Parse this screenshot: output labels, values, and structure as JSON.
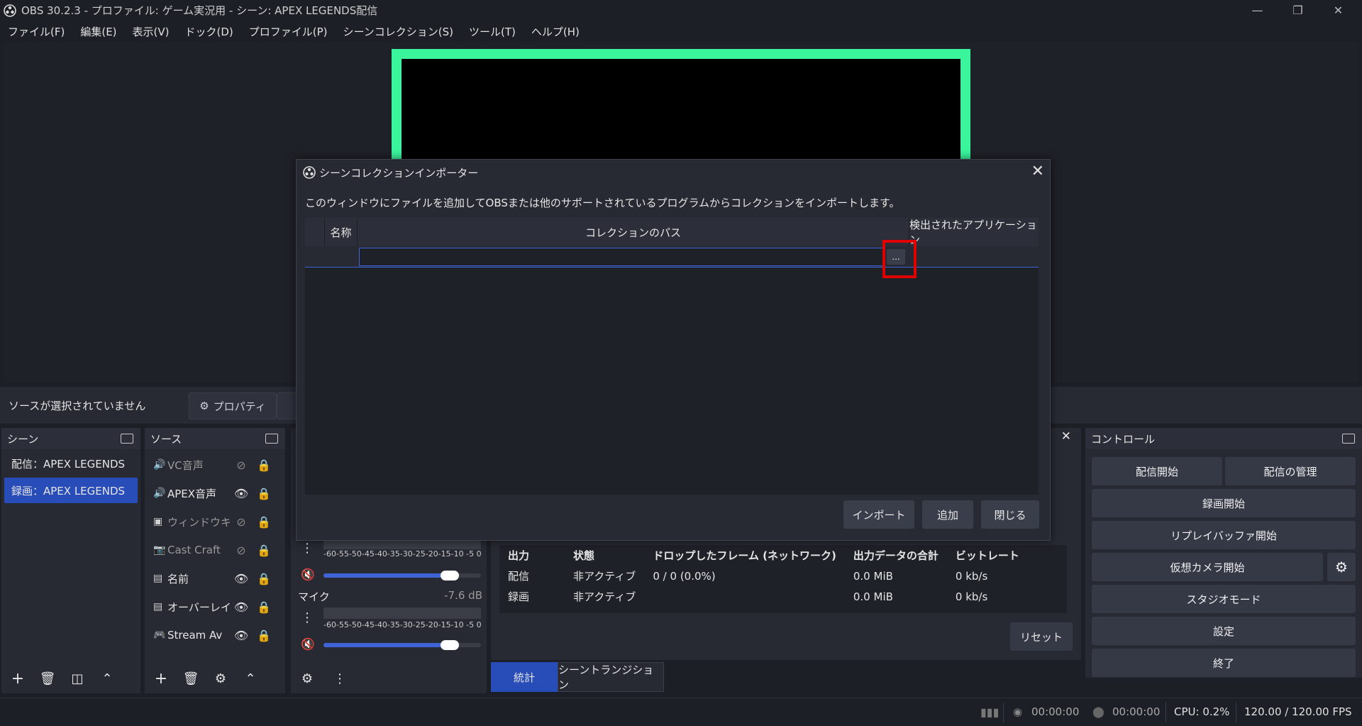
{
  "window": {
    "title": "OBS 30.2.3 - プロファイル: ゲーム実況用 - シーン: APEX LEGENDS配信"
  },
  "menu": [
    "ファイル(F)",
    "編集(E)",
    "表示(V)",
    "ドック(D)",
    "プロファイル(P)",
    "シーンコレクション(S)",
    "ツール(T)",
    "ヘルプ(H)"
  ],
  "source_bar": {
    "no_selection": "ソースが選択されていません",
    "properties": "プロパティ"
  },
  "scenes": {
    "title": "シーン",
    "items": [
      "配信：APEX LEGENDS",
      "録画：APEX LEGENDS"
    ],
    "selected_index": 1
  },
  "sources": {
    "title": "ソース",
    "items": [
      {
        "name": "VC音声",
        "icon": "speaker-icon",
        "visible": false
      },
      {
        "name": "APEX音声",
        "icon": "speaker-icon",
        "visible": true
      },
      {
        "name": "ウィンドウキ",
        "icon": "window-icon",
        "visible": false
      },
      {
        "name": "Cast Craft",
        "icon": "camera-icon",
        "visible": false
      },
      {
        "name": "名前",
        "icon": "image-icon",
        "visible": true
      },
      {
        "name": "オーバーレイ",
        "icon": "image-icon",
        "visible": true
      },
      {
        "name": "Stream Av",
        "icon": "gamepad-icon",
        "visible": true
      }
    ]
  },
  "mixer": {
    "scale": "-60-55-50-45-40-35-30-25-20-15-10 -5  0",
    "mic_label": "マイク",
    "mic_db": "-7.6 dB",
    "track1_volume": 0.8,
    "mic_volume": 0.8
  },
  "stats": {
    "headers": [
      "出力",
      "状態",
      "ドロップしたフレーム (ネットワーク)",
      "出力データの合計",
      "ビットレート"
    ],
    "rows": [
      [
        "配信",
        "非アクティブ",
        "0 / 0 (0.0%)",
        "0.0 MiB",
        "0 kb/s"
      ],
      [
        "録画",
        "非アクティブ",
        "",
        "0.0 MiB",
        "0 kb/s"
      ]
    ],
    "reset": "リセット",
    "tabs": [
      "統計",
      "シーントランジション"
    ]
  },
  "controls": {
    "title": "コントロール",
    "start_stream": "配信開始",
    "manage_stream": "配信の管理",
    "start_recording": "録画開始",
    "start_replay": "リプレイバッファ開始",
    "start_virtualcam": "仮想カメラ開始",
    "studio_mode": "スタジオモード",
    "settings": "設定",
    "exit": "終了"
  },
  "status": {
    "stream_time": "00:00:00",
    "record_time": "00:00:00",
    "cpu": "CPU: 0.2%",
    "fps": "120.00 / 120.00 FPS"
  },
  "dialog": {
    "title": "シーンコレクションインポーター",
    "description": "このウィンドウにファイルを追加してOBSまたは他のサポートされているプログラムからコレクションをインポートします。",
    "columns": [
      "名称",
      "コレクションのパス",
      "検出されたアプリケーション"
    ],
    "path_value": "",
    "browse": "...",
    "import": "インポート",
    "add": "追加",
    "close": "閉じる"
  },
  "colors": {
    "accent": "#284cb8",
    "highlight": "#e00000",
    "canvas_border": "#3af59c"
  }
}
